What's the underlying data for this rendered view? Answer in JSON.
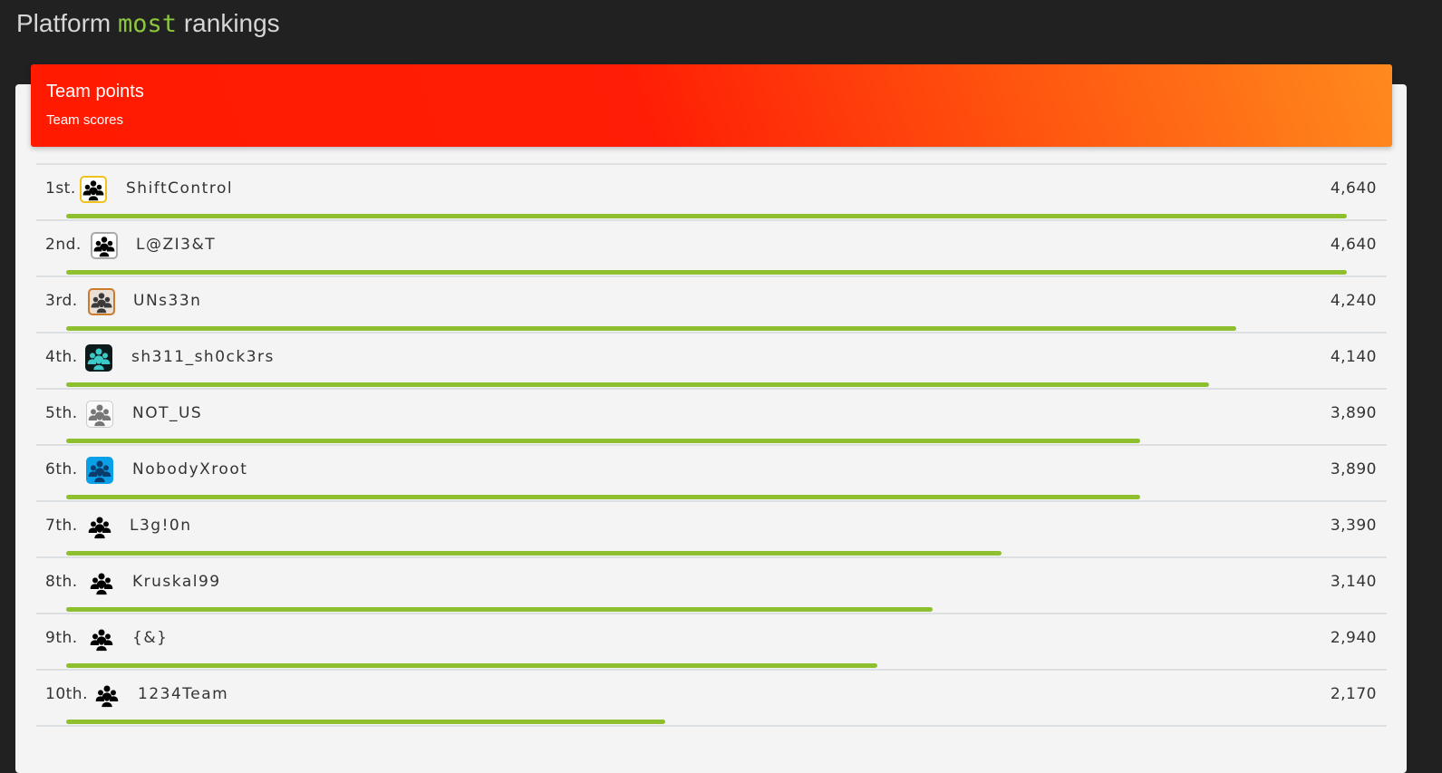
{
  "page": {
    "title_prefix": "Platform",
    "title_highlight": "most",
    "title_suffix": "rankings"
  },
  "card": {
    "title": "Team points",
    "subtitle": "Team scores"
  },
  "rows": [
    {
      "rank": "1st.",
      "team": "ShiftControl",
      "score": "4,640",
      "score_value": 4640,
      "avatar_style": "gold"
    },
    {
      "rank": "2nd.",
      "team": "L@ZI3&T",
      "score": "4,640",
      "score_value": 4640,
      "avatar_style": "silver"
    },
    {
      "rank": "3rd.",
      "team": "UNs33n",
      "score": "4,240",
      "score_value": 4240,
      "avatar_style": "bronze"
    },
    {
      "rank": "4th.",
      "team": "sh311_sh0ck3rs",
      "score": "4,140",
      "score_value": 4140,
      "avatar_style": "dark"
    },
    {
      "rank": "5th.",
      "team": "NOT_US",
      "score": "3,890",
      "score_value": 3890,
      "avatar_style": "sketch"
    },
    {
      "rank": "6th.",
      "team": "NobodyXroot",
      "score": "3,890",
      "score_value": 3890,
      "avatar_style": "blue"
    },
    {
      "rank": "7th.",
      "team": "L3g!0n",
      "score": "3,390",
      "score_value": 3390,
      "avatar_style": "plain"
    },
    {
      "rank": "8th.",
      "team": "Kruskal99",
      "score": "3,140",
      "score_value": 3140,
      "avatar_style": "plain"
    },
    {
      "rank": "9th.",
      "team": "{&}",
      "score": "2,940",
      "score_value": 2940,
      "avatar_style": "plain"
    },
    {
      "rank": "10th.",
      "team": "1234Team",
      "score": "2,170",
      "score_value": 2170,
      "avatar_style": "plain"
    }
  ],
  "max_score": 4640,
  "colors": {
    "bar": "#8dbf2e",
    "highlight": "#8dc63f",
    "header_start": "#ff1a00",
    "header_end": "#ff8a1e"
  }
}
